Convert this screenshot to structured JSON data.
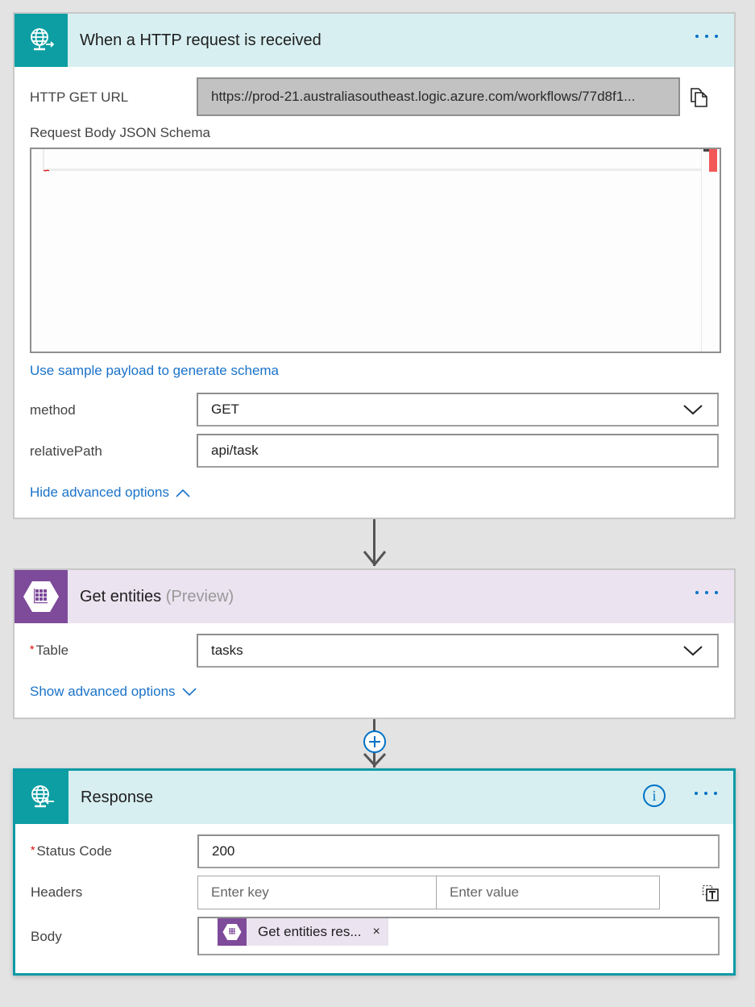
{
  "trigger": {
    "title": "When a HTTP request is received",
    "icon": "http-request-globe-icon",
    "header_color": "#d7eff1",
    "icon_bg_color": "#0d9ea3",
    "fields": {
      "url_label": "HTTP GET URL",
      "url_value": "https://prod-21.australiasoutheast.logic.azure.com/workflows/77d8f1...",
      "schema_label": "Request Body JSON Schema",
      "schema_link": "Use sample payload to generate schema",
      "method_label": "method",
      "method_value": "GET",
      "relative_path_label": "relativePath",
      "relative_path_value": "api/task",
      "advanced_toggle": "Hide advanced options"
    }
  },
  "get_entities": {
    "title": "Get entities",
    "subtitle": "(Preview)",
    "icon": "azure-table-storage-icon",
    "header_color": "#ebe3f0",
    "icon_bg_color": "#7e4a9a",
    "fields": {
      "table_required_mark": "*",
      "table_label": "Table",
      "table_value": "tasks",
      "advanced_toggle": "Show advanced options"
    }
  },
  "response": {
    "title": "Response",
    "icon": "http-response-globe-icon",
    "header_color": "#d7eff1",
    "border_color": "#0d9aa5",
    "fields": {
      "status_required_mark": "*",
      "status_label": "Status Code",
      "status_value": "200",
      "headers_label": "Headers",
      "header_key_placeholder": "Enter key",
      "header_value_placeholder": "Enter value",
      "body_label": "Body",
      "body_token": "Get entities res...",
      "body_token_remove": "×"
    }
  },
  "accent_color": "#0072c6",
  "link_color": "#1a73c9"
}
